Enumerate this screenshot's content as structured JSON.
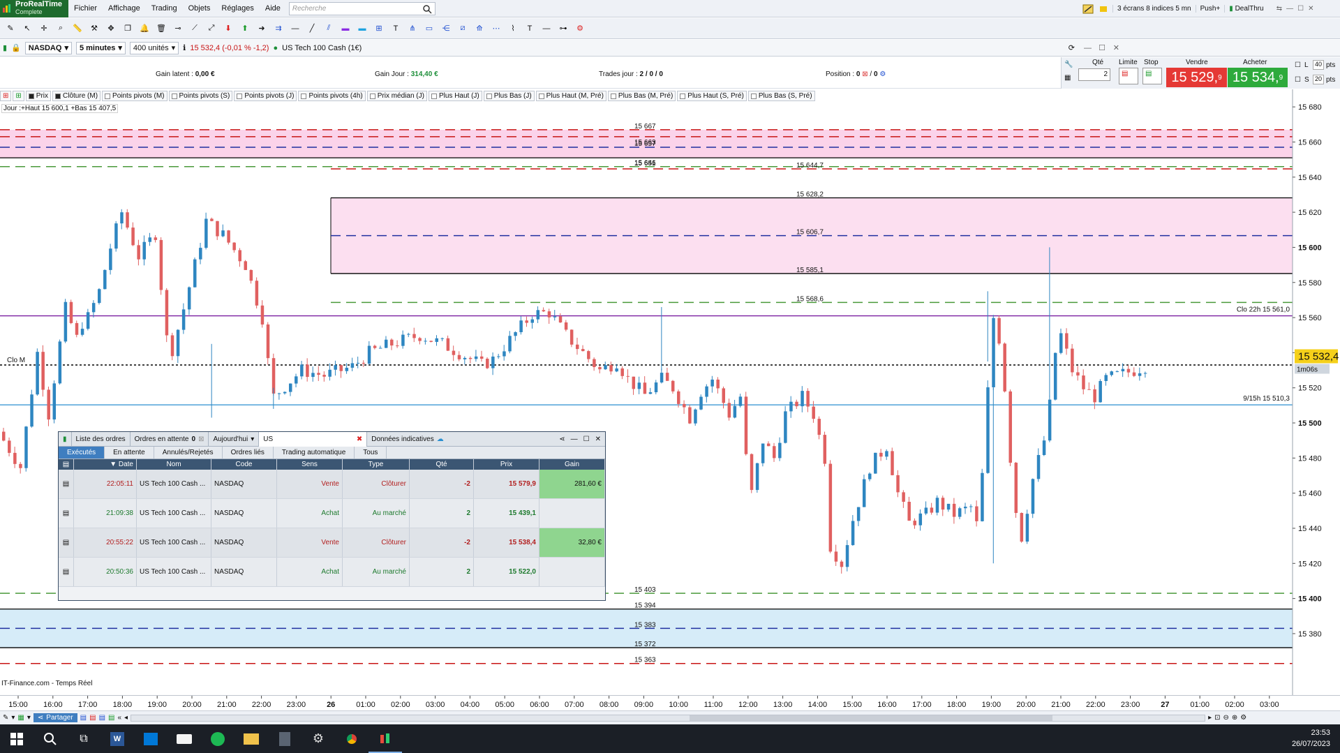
{
  "app": {
    "brand": "ProRealTime",
    "edition": "Complete"
  },
  "menu": [
    "Fichier",
    "Affichage",
    "Trading",
    "Objets",
    "Réglages",
    "Aide"
  ],
  "search": {
    "placeholder": "Recherche"
  },
  "topright": {
    "layout": "3 écrans 8 indices 5 mn",
    "push": "Push+",
    "dealthru": "DealThru"
  },
  "instrument": {
    "symbol": "NASDAQ",
    "timeframe": "5 minutes",
    "units": "400 unités",
    "quote": "15 532,4 (-0,01 % -1,2)",
    "name": "US Tech 100 Cash (1€)"
  },
  "summary": {
    "gain_latent_label": "Gain latent :",
    "gain_latent": "0,00 €",
    "gain_jour_label": "Gain Jour :",
    "gain_jour": "314,40 €",
    "trades_label": "Trades jour :",
    "trades": "2 / 0 / 0",
    "position_label": "Position :",
    "position_a": "0",
    "position_b": "0"
  },
  "order_panel": {
    "qte_label": "Qté",
    "qte": "2",
    "limite_label": "Limite",
    "stop_label": "Stop",
    "vendre_label": "Vendre",
    "acheter_label": "Acheter",
    "vendre_price": "15 529,",
    "vendre_sup": "9",
    "acheter_price": "15 534,",
    "acheter_sup": "9",
    "l_label": "L",
    "s_label": "S",
    "l_pts": "40",
    "s_pts": "20",
    "pts": "pts"
  },
  "indicators": [
    "Prix",
    "Clôture (M)",
    "Points pivots (M)",
    "Points pivots (S)",
    "Points pivots (J)",
    "Points pivots (4h)",
    "Prix médian (J)",
    "Plus Haut (J)",
    "Plus Bas (J)",
    "Plus Haut (M, Pré)",
    "Plus Bas (M, Pré)",
    "Plus Haut (S, Pré)",
    "Plus Bas (S, Pré)"
  ],
  "day_note": "Jour :+Haut 15 600,1 +Bas 15 407,5",
  "chart_data": {
    "type": "candlestick",
    "ylim": [
      15345,
      15690
    ],
    "y_ticks": [
      15680,
      15660,
      15640,
      15620,
      15600,
      15580,
      15560,
      15540,
      15520,
      15500,
      15480,
      15460,
      15440,
      15420,
      15400,
      15380
    ],
    "y_tick_labels": [
      "15 680",
      "15 660",
      "15 640",
      "15 620",
      "15 600",
      "15 580",
      "15 560",
      "15 540",
      "15 520",
      "15 500",
      "15 480",
      "15 460",
      "15 440",
      "15 420",
      "15 400",
      "15 380"
    ],
    "x_ticks": [
      "15:00",
      "16:00",
      "17:00",
      "18:00",
      "19:00",
      "20:00",
      "21:00",
      "22:00",
      "23:00",
      "26",
      "01:00",
      "02:00",
      "03:00",
      "04:00",
      "05:00",
      "06:00",
      "07:00",
      "08:00",
      "09:00",
      "10:00",
      "11:00",
      "12:00",
      "13:00",
      "14:00",
      "15:00",
      "16:00",
      "17:00",
      "18:00",
      "19:00",
      "20:00",
      "21:00",
      "22:00",
      "23:00",
      "27",
      "01:00",
      "02:00",
      "03:00"
    ],
    "last_price": "15 532,4",
    "countdown": "1m06s",
    "levels": [
      {
        "label": "15 667",
        "value": 15667,
        "color": "#c81414",
        "style": "dash"
      },
      {
        "label": "15 663",
        "value": 15663,
        "color": "#c81414",
        "style": "dash"
      },
      {
        "label": "15 657",
        "value": 15657,
        "color": "#2030a0",
        "style": "dash"
      },
      {
        "label": "15 651",
        "value": 15651,
        "color": "#000000",
        "style": "solid"
      },
      {
        "label": "15 646",
        "value": 15646,
        "color": "#4a9a3a",
        "style": "dash"
      },
      {
        "label": "15 644,7",
        "value": 15644.7,
        "color": "#c81414",
        "style": "dash"
      },
      {
        "label": "15 628,2",
        "value": 15628.2,
        "color": "#000000",
        "style": "solid"
      },
      {
        "label": "15 606,7",
        "value": 15606.7,
        "color": "#2030a0",
        "style": "dash"
      },
      {
        "label": "15 585,1",
        "value": 15585.1,
        "color": "#000000",
        "style": "solid"
      },
      {
        "label": "15 568,6",
        "value": 15568.6,
        "color": "#4a9a3a",
        "style": "dash"
      },
      {
        "label": "Clo 22h 15 561,0",
        "value": 15561.0,
        "color": "#7a1fa0",
        "style": "solid"
      },
      {
        "label": "Clo M",
        "value": 15533,
        "color": "#000000",
        "style": "dot"
      },
      {
        "label": "9/15h 15 510,3",
        "value": 15510.3,
        "color": "#2a8fd0",
        "style": "solid"
      },
      {
        "label": "15 403",
        "value": 15403,
        "color": "#4a9a3a",
        "style": "dash"
      },
      {
        "label": "15 394",
        "value": 15394,
        "color": "#000000",
        "style": "solid"
      },
      {
        "label": "15 383",
        "value": 15383,
        "color": "#2030a0",
        "style": "dash"
      },
      {
        "label": "15 372",
        "value": 15372,
        "color": "#000000",
        "style": "solid"
      },
      {
        "label": "15 363",
        "value": 15363,
        "color": "#c81414",
        "style": "dash"
      }
    ],
    "zones": [
      {
        "from": 15651,
        "to": 15667,
        "color": "#fbd3ea"
      },
      {
        "from": 15585.1,
        "to": 15628.2,
        "color": "#fcdff0"
      },
      {
        "from": 15372,
        "to": 15394,
        "color": "#d6ecf8"
      }
    ],
    "path": [
      [
        0,
        15495
      ],
      [
        4,
        15475
      ],
      [
        7,
        15540
      ],
      [
        9,
        15505
      ],
      [
        12,
        15565
      ],
      [
        14,
        15548
      ],
      [
        15,
        15557
      ],
      [
        16,
        15560
      ],
      [
        18,
        15575
      ],
      [
        20,
        15600
      ],
      [
        22,
        15620
      ],
      [
        25,
        15595
      ],
      [
        28,
        15608
      ],
      [
        30,
        15548
      ],
      [
        31,
        15542
      ],
      [
        33,
        15565
      ],
      [
        37,
        15615
      ],
      [
        40,
        15607
      ],
      [
        44,
        15590
      ],
      [
        47,
        15560
      ],
      [
        48,
        15535
      ],
      [
        49,
        15515
      ],
      [
        54,
        15530
      ],
      [
        58,
        15527
      ],
      [
        63,
        15532
      ],
      [
        66,
        15540
      ],
      [
        70,
        15545
      ],
      [
        75,
        15550
      ],
      [
        79,
        15545
      ],
      [
        82,
        15540
      ],
      [
        86,
        15533
      ],
      [
        88,
        15536
      ],
      [
        92,
        15551
      ],
      [
        95,
        15562
      ],
      [
        98,
        15563
      ],
      [
        101,
        15550
      ],
      [
        104,
        15540
      ],
      [
        107,
        15530
      ],
      [
        110,
        15535
      ],
      [
        112,
        15525
      ],
      [
        115,
        15516
      ],
      [
        118,
        15525
      ],
      [
        120,
        15520
      ],
      [
        123,
        15503
      ],
      [
        125,
        15518
      ],
      [
        127,
        15525
      ],
      [
        130,
        15505
      ],
      [
        132,
        15515
      ],
      [
        133,
        15480
      ],
      [
        134,
        15460
      ],
      [
        136,
        15490
      ],
      [
        138,
        15480
      ],
      [
        140,
        15505
      ],
      [
        143,
        15515
      ],
      [
        145,
        15505
      ],
      [
        147,
        15480
      ],
      [
        148,
        15430
      ],
      [
        150,
        15420
      ],
      [
        152,
        15445
      ],
      [
        155,
        15475
      ],
      [
        158,
        15487
      ],
      [
        160,
        15460
      ],
      [
        162,
        15443
      ],
      [
        165,
        15448
      ],
      [
        167,
        15455
      ],
      [
        170,
        15448
      ],
      [
        173,
        15452
      ],
      [
        174,
        15442
      ],
      [
        175,
        15470
      ],
      [
        176,
        15518
      ],
      [
        177,
        15560
      ],
      [
        178,
        15548
      ],
      [
        179,
        15520
      ],
      [
        180,
        15480
      ],
      [
        181,
        15450
      ],
      [
        182,
        15435
      ],
      [
        184,
        15468
      ],
      [
        186,
        15490
      ],
      [
        187,
        15510
      ],
      [
        188,
        15540
      ],
      [
        189,
        15550
      ],
      [
        191,
        15530
      ],
      [
        193,
        15520
      ],
      [
        195,
        15515
      ],
      [
        197,
        15525
      ],
      [
        200,
        15528
      ],
      [
        202,
        15530
      ],
      [
        204,
        15532.4
      ]
    ],
    "spikes": [
      [
        37,
        15503,
        15545
      ],
      [
        48,
        15508,
        15520
      ],
      [
        117,
        15530,
        15566
      ],
      [
        175,
        15535,
        15575
      ],
      [
        176,
        15420,
        15520
      ],
      [
        186,
        15515,
        15600
      ]
    ]
  },
  "orders": {
    "tabs_top": [
      "Liste des ordres",
      "Ordres en attente",
      "Aujourd'hui"
    ],
    "pending_count": "0",
    "filter": "US",
    "donnees": "Données indicatives",
    "tabs": [
      "Exécutés",
      "En attente",
      "Annulés/Rejetés",
      "Ordres liés",
      "Trading automatique",
      "Tous"
    ],
    "columns": [
      "Date",
      "Nom",
      "Code",
      "Sens",
      "Type",
      "Qté",
      "Prix",
      "Gain"
    ],
    "rows": [
      {
        "date": "22:05:11",
        "nom": "US Tech 100 Cash ...",
        "code": "NASDAQ",
        "sens": "Vente",
        "type": "Clôturer",
        "qte": "-2",
        "prix": "15 579,9",
        "gain": "281,60 €",
        "dir": "sell"
      },
      {
        "date": "21:09:38",
        "nom": "US Tech 100 Cash ...",
        "code": "NASDAQ",
        "sens": "Achat",
        "type": "Au marché",
        "qte": "2",
        "prix": "15 439,1",
        "gain": "",
        "dir": "buy"
      },
      {
        "date": "20:55:22",
        "nom": "US Tech 100 Cash ...",
        "code": "NASDAQ",
        "sens": "Vente",
        "type": "Clôturer",
        "qte": "-2",
        "prix": "15 538,4",
        "gain": "32,80 €",
        "dir": "sell"
      },
      {
        "date": "20:50:36",
        "nom": "US Tech 100 Cash ...",
        "code": "NASDAQ",
        "sens": "Achat",
        "type": "Au marché",
        "qte": "2",
        "prix": "15 522,0",
        "gain": "",
        "dir": "buy"
      }
    ]
  },
  "footer": {
    "source": "IT-Finance.com - Temps Réel",
    "share": "Partager"
  },
  "taskbar": {
    "time": "23:53",
    "date": "26/07/2023"
  },
  "colors": {
    "up": "#2e86c1",
    "down": "#e06060",
    "accent": "#3f7ec0",
    "sell_bg": "#e53935",
    "buy_bg": "#2eaa3c"
  }
}
